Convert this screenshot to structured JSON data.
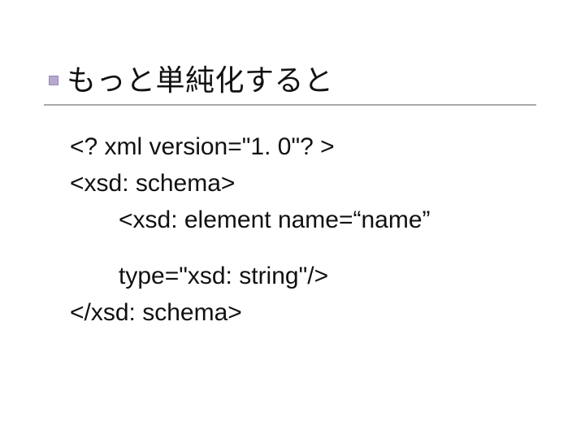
{
  "title": "もっと単純化すると",
  "code": {
    "l1": "<? xml version=\"1. 0\"? >",
    "l2": "<xsd: schema>",
    "l3": "<xsd: element name=“name”",
    "l4": "type=\"xsd: string\"/>",
    "l5": "</xsd: schema>"
  }
}
